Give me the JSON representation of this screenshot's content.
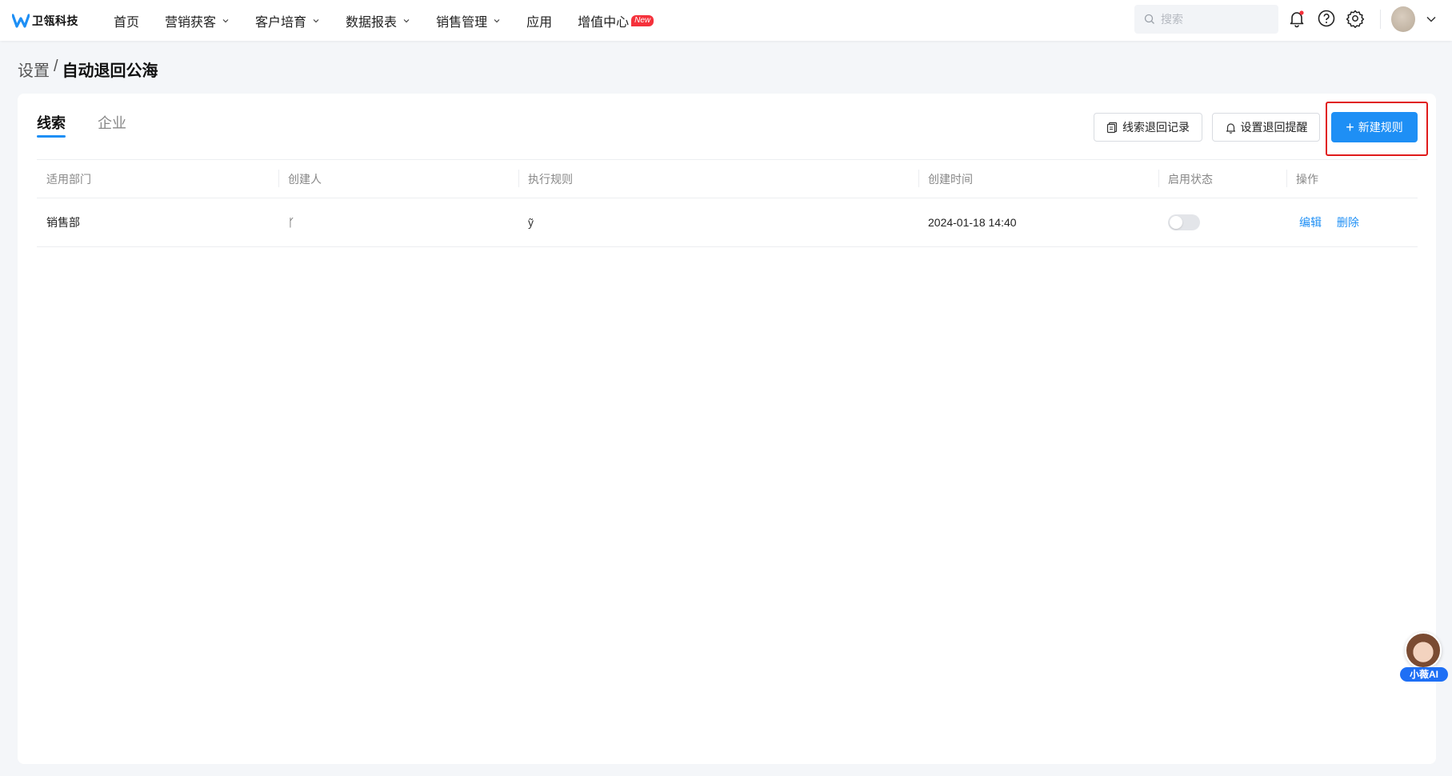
{
  "app": {
    "logo_text": "卫瓴科技",
    "brand_color": "#1e8ff5"
  },
  "nav": {
    "items": [
      {
        "label": "首页",
        "has_dropdown": false
      },
      {
        "label": "营销获客",
        "has_dropdown": true
      },
      {
        "label": "客户培育",
        "has_dropdown": true
      },
      {
        "label": "数据报表",
        "has_dropdown": true
      },
      {
        "label": "销售管理",
        "has_dropdown": true
      },
      {
        "label": "应用",
        "has_dropdown": false
      },
      {
        "label": "增值中心",
        "has_dropdown": false,
        "badge": "New"
      }
    ]
  },
  "search": {
    "placeholder": "搜索",
    "value": ""
  },
  "header_icons": [
    "bell-icon",
    "help-icon",
    "gear-icon"
  ],
  "breadcrumb": {
    "parent": "设置",
    "separator": "/",
    "current": "自动退回公海"
  },
  "tabs": [
    {
      "label": "线索",
      "active": true
    },
    {
      "label": "企业",
      "active": false
    }
  ],
  "toolbar": {
    "records_label": "线索退回记录",
    "reminder_label": "设置退回提醒",
    "new_rule_label": "新建规则"
  },
  "table": {
    "headers": [
      "适用部门",
      "创建人",
      "执行规则",
      "创建时间",
      "启用状态",
      "操作"
    ],
    "rows": [
      {
        "department": "销售部",
        "creator": "ᚴ",
        "rule": "ỹ",
        "created_at": "2024-01-18 14:40",
        "enabled": false,
        "actions": [
          "编辑",
          "删除"
        ]
      }
    ]
  },
  "assistant": {
    "label": "小薇AI"
  }
}
